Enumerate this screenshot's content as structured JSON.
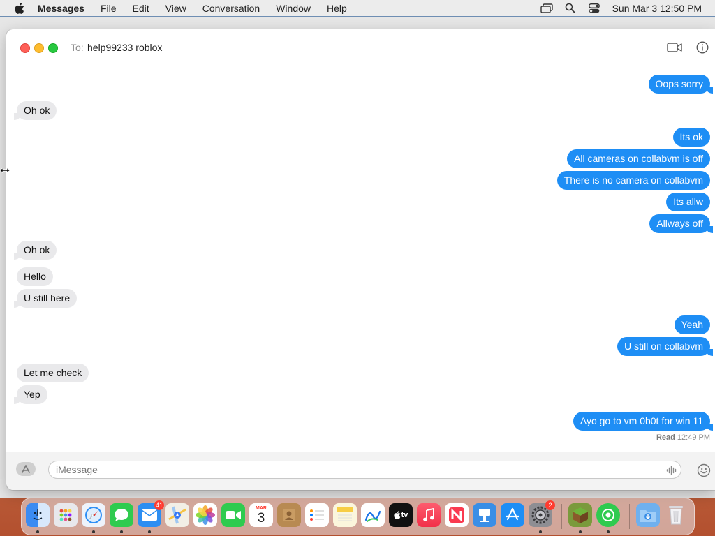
{
  "menubar": {
    "app": "Messages",
    "menus": [
      "File",
      "Edit",
      "View",
      "Conversation",
      "Window",
      "Help"
    ],
    "clock": "Sun Mar 3  12:50 PM"
  },
  "window": {
    "to_label": "To:",
    "recipient": "help99233 roblox"
  },
  "messages": [
    {
      "dir": "out",
      "text": "Oops sorry"
    },
    {
      "dir": "in",
      "text": "Oh ok"
    },
    {
      "dir": "out",
      "text": "Its ok"
    },
    {
      "dir": "out",
      "text": "All cameras on collabvm is off"
    },
    {
      "dir": "out",
      "text": "There is no camera on collabvm"
    },
    {
      "dir": "out",
      "text": "Its allw"
    },
    {
      "dir": "out",
      "text": "Allways off"
    },
    {
      "dir": "in",
      "text": "Oh ok"
    },
    {
      "dir": "in",
      "text": "Hello"
    },
    {
      "dir": "in",
      "text": "U still here"
    },
    {
      "dir": "out",
      "text": "Yeah"
    },
    {
      "dir": "out",
      "text": "U still on collabvm"
    },
    {
      "dir": "in",
      "text": "Let me check"
    },
    {
      "dir": "in",
      "text": "Yep"
    },
    {
      "dir": "out",
      "text": "Ayo go to vm 0b0t for win 11"
    }
  ],
  "read_receipt": {
    "label": "Read",
    "time": "12:49 PM"
  },
  "compose": {
    "placeholder": "iMessage"
  },
  "dock": {
    "calendar_month": "MAR",
    "calendar_day": "3",
    "mail_badge": "41",
    "settings_badge": "2",
    "tv_label": "tv",
    "colors": {
      "outgoing": "#1e8ef5",
      "incoming": "#e9e9eb"
    }
  }
}
